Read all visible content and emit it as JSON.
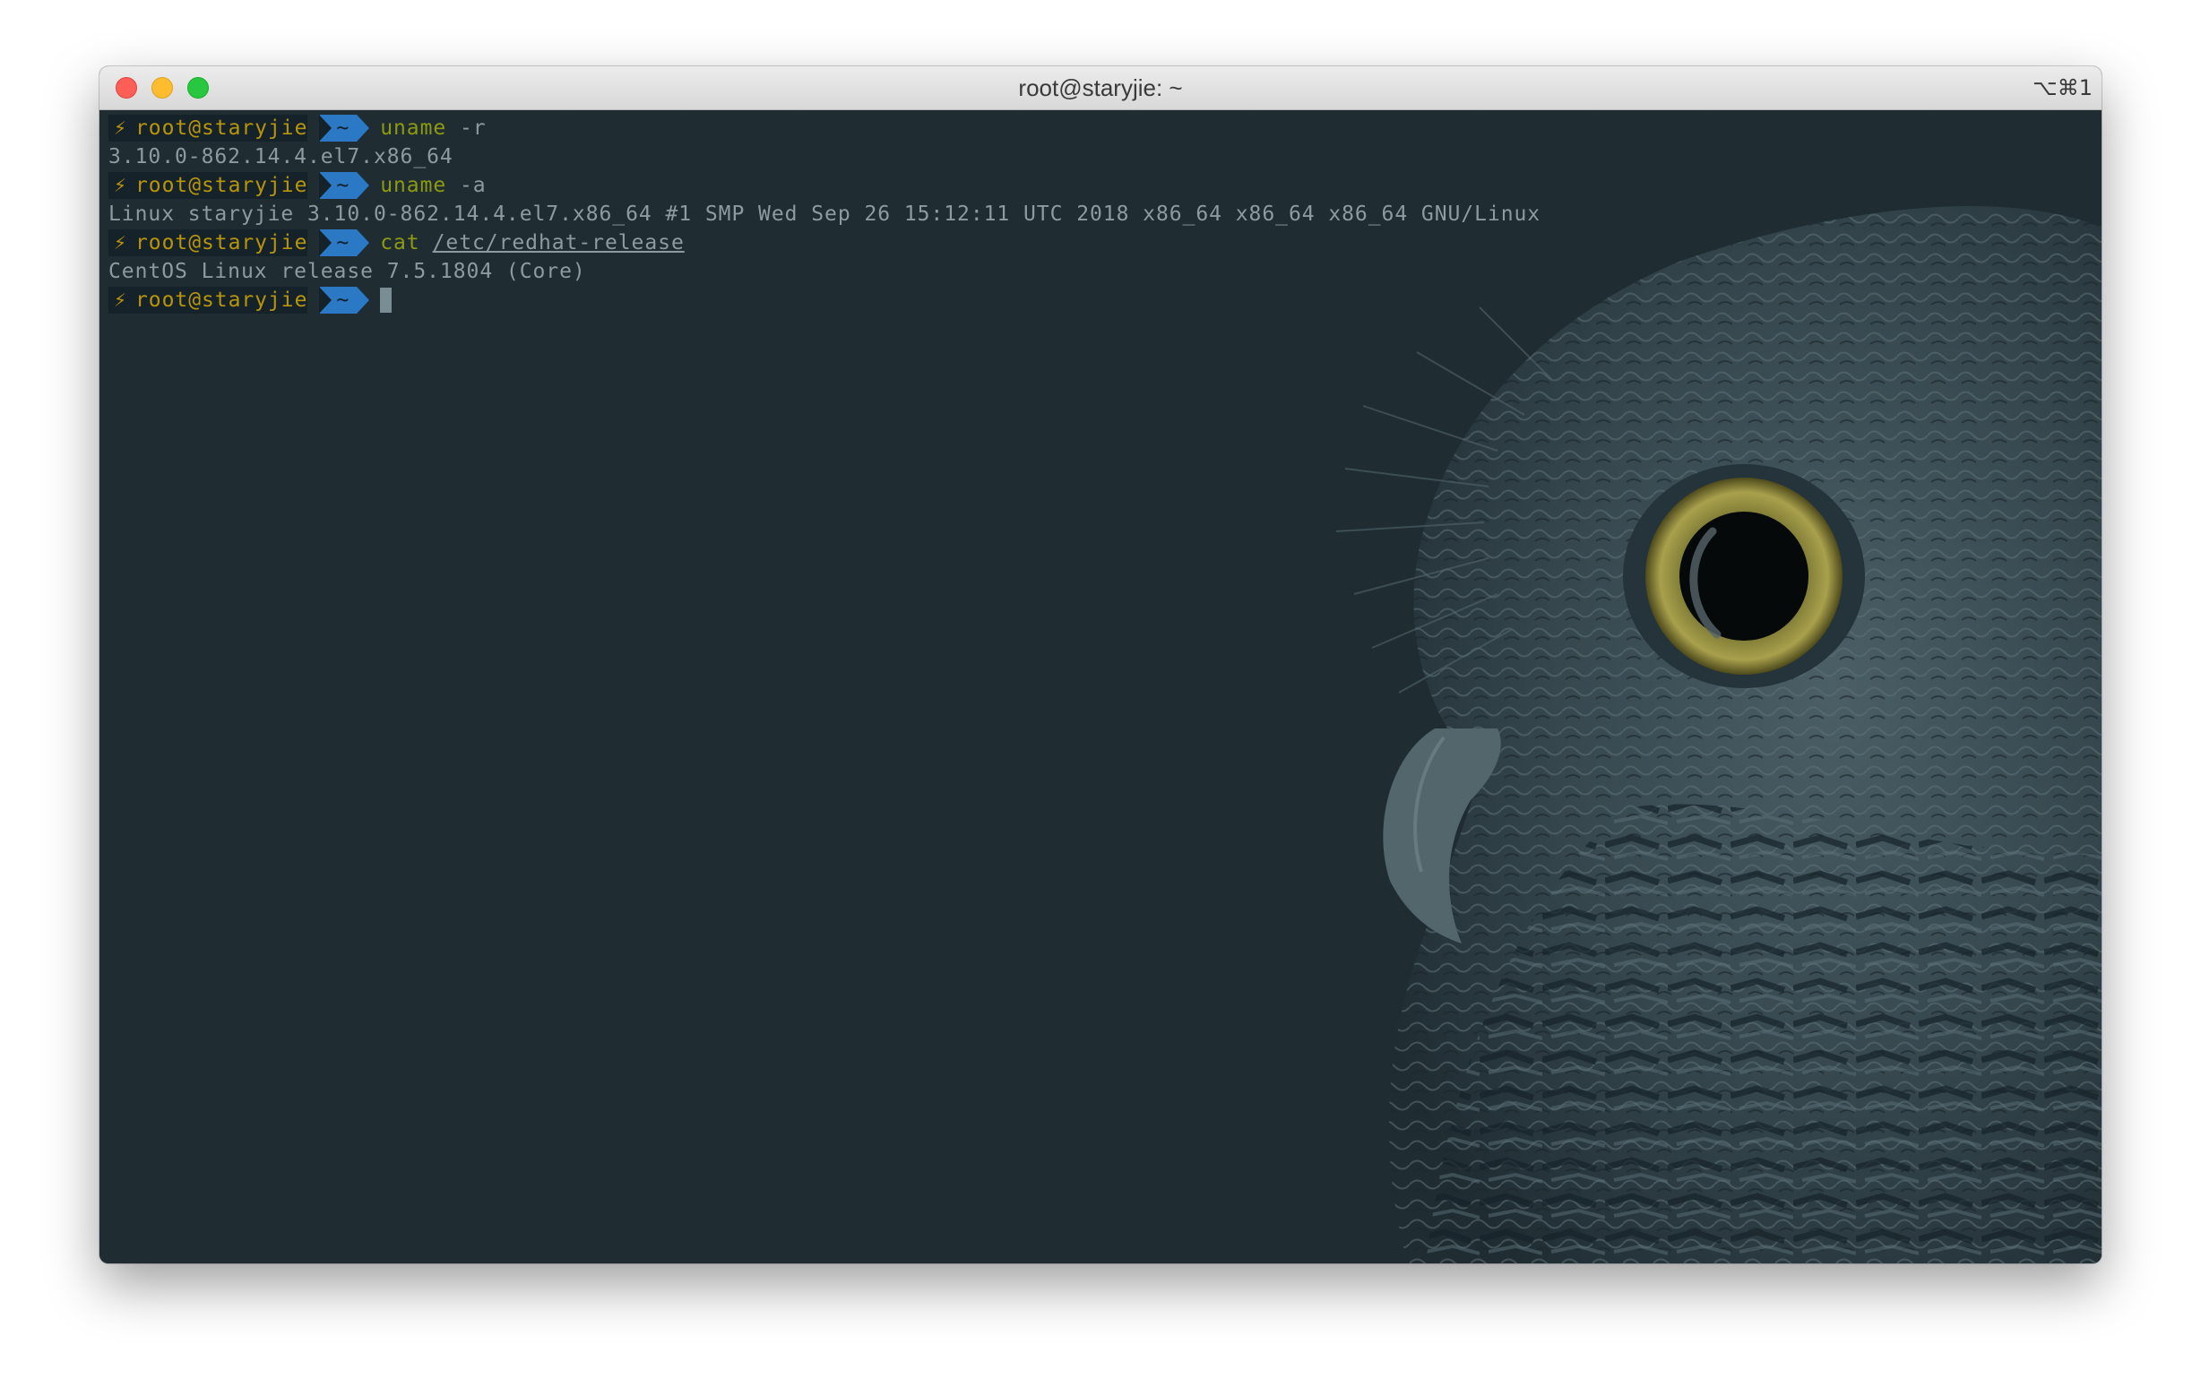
{
  "window": {
    "title": "root@staryjie: ~",
    "shortcut": "⌥⌘1"
  },
  "prompt": {
    "icon": "⚡",
    "host": "root@staryjie",
    "dir": "~"
  },
  "lines": [
    {
      "type": "prompt",
      "cmd": "uname",
      "args": " -r"
    },
    {
      "type": "output",
      "text": "3.10.0-862.14.4.el7.x86_64"
    },
    {
      "type": "prompt",
      "cmd": "uname",
      "args": " -a"
    },
    {
      "type": "output",
      "text": "Linux staryjie 3.10.0-862.14.4.el7.x86_64 #1 SMP Wed Sep 26 15:12:11 UTC 2018 x86_64 x86_64 x86_64 GNU/Linux"
    },
    {
      "type": "prompt",
      "cmd": "cat",
      "args": "/etc/redhat-release"
    },
    {
      "type": "output",
      "text": "CentOS Linux release 7.5.1804 (Core)"
    },
    {
      "type": "prompt",
      "cmd": "",
      "args": ""
    }
  ],
  "colors": {
    "background": "#1f2d33",
    "prompt_host": "#b7950b",
    "prompt_dir_bg": "#2b78c5",
    "command": "#8d9a11",
    "output": "#8c9ba1"
  },
  "background_image": "owl-wallpaper"
}
